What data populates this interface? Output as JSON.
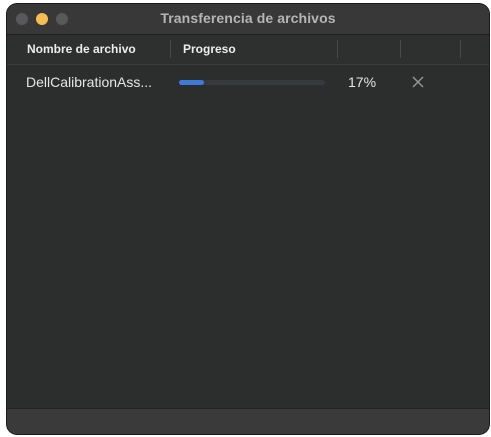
{
  "window": {
    "title": "Transferencia de archivos"
  },
  "table": {
    "columns": [
      "Nombre de archivo",
      "Progreso",
      "",
      ""
    ],
    "rows": [
      {
        "filename": "DellCalibrationAss...",
        "progress_fraction": 0.17,
        "percent_label": "17%",
        "action_icon": "close-icon"
      }
    ]
  },
  "colors": {
    "window_bg": "#2c2d2d",
    "progress_fill": "#3e7bd8",
    "progress_track": "#36393d",
    "minimize_button": "#f4bf4f"
  }
}
